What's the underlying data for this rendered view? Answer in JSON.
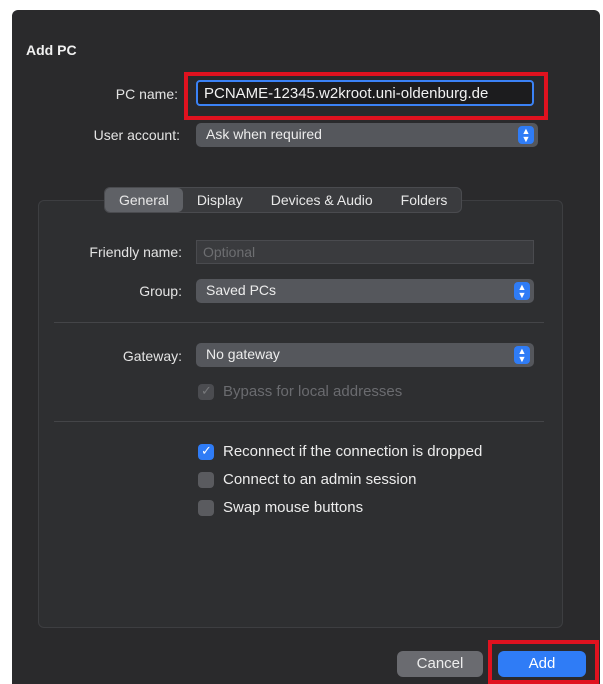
{
  "dialog": {
    "title": "Add PC"
  },
  "pc_name": {
    "label": "PC name:",
    "value": "PCNAME-12345.w2kroot.uni-oldenburg.de"
  },
  "user_account": {
    "label": "User account:",
    "value": "Ask when required"
  },
  "tabs": [
    {
      "label": "General",
      "active": true
    },
    {
      "label": "Display",
      "active": false
    },
    {
      "label": "Devices & Audio",
      "active": false
    },
    {
      "label": "Folders",
      "active": false
    }
  ],
  "friendly_name": {
    "label": "Friendly name:",
    "placeholder": "Optional"
  },
  "group": {
    "label": "Group:",
    "value": "Saved PCs"
  },
  "gateway": {
    "label": "Gateway:",
    "value": "No gateway"
  },
  "bypass": {
    "label": "Bypass for local addresses",
    "checked": true,
    "enabled": false
  },
  "options": [
    {
      "label": "Reconnect if the connection is dropped",
      "checked": true
    },
    {
      "label": "Connect to an admin session",
      "checked": false
    },
    {
      "label": "Swap mouse buttons",
      "checked": false
    }
  ],
  "buttons": {
    "cancel": "Cancel",
    "add": "Add"
  },
  "colors": {
    "accent": "#2f7cf6",
    "highlight": "#e0121f",
    "background": "#2a2a2c"
  },
  "icons": {
    "popup": "chevron-updown-icon",
    "check": "checkmark-icon"
  }
}
